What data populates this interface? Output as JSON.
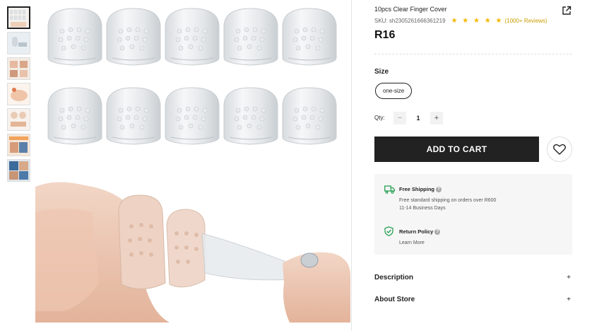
{
  "thumbnails": [
    {
      "name": "thumb-1",
      "active": true
    },
    {
      "name": "thumb-2",
      "active": false
    },
    {
      "name": "thumb-3",
      "active": false
    },
    {
      "name": "thumb-4",
      "active": false
    },
    {
      "name": "thumb-5",
      "active": false
    },
    {
      "name": "thumb-6",
      "active": false
    },
    {
      "name": "thumb-7",
      "active": false
    }
  ],
  "product": {
    "title": "10pcs Clear Finger Cover",
    "sku": "SKU: sh2305261666361219",
    "stars": "★ ★ ★ ★ ★",
    "reviews": "(1000+ Reviews)",
    "price": "R16"
  },
  "size": {
    "label": "Size",
    "selected": "one-size"
  },
  "quantity": {
    "label": "Qty:",
    "value": "1",
    "minus": "−",
    "plus": "+"
  },
  "actions": {
    "add_to_cart": "ADD TO CART"
  },
  "shipping": {
    "title": "Free Shipping",
    "line1": "Free standard shipping on orders over R600",
    "line2": "11-14 Business Days"
  },
  "returns": {
    "title": "Return Policy",
    "link": "Learn More"
  },
  "accordions": {
    "description": "Description",
    "about_store": "About Store",
    "plus": "+"
  },
  "colors": {
    "accent_star": "#f5b800",
    "button_dark": "#222222",
    "shipping_green": "#1a9a4a"
  }
}
